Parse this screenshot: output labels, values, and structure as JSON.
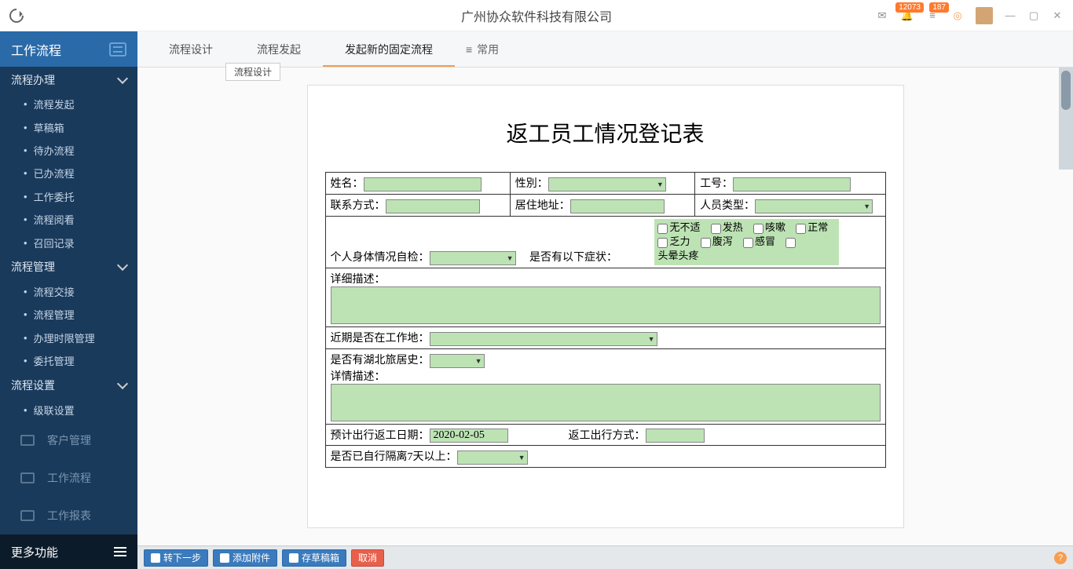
{
  "title": "广州协众软件科技有限公司",
  "badges": {
    "bell": "12073",
    "list": "187"
  },
  "sidebar": {
    "header": "工作流程",
    "group1": "流程办理",
    "items1": [
      "流程发起",
      "草稿箱",
      "待办流程",
      "已办流程",
      "工作委托",
      "流程阅看",
      "召回记录"
    ],
    "group2": "流程管理",
    "items2": [
      "流程交接",
      "流程管理",
      "办理时限管理",
      "委托管理"
    ],
    "group3": "流程设置",
    "items3": [
      "级联设置"
    ],
    "big": [
      "客户管理",
      "工作流程",
      "工作报表"
    ],
    "more": "更多功能"
  },
  "tabs": [
    "流程设计",
    "流程发起",
    "发起新的固定流程"
  ],
  "tabMore": "常用",
  "tooltip": "流程设计",
  "form": {
    "title": "返工员工情况登记表",
    "name": "姓名：",
    "gender": "性別：",
    "empno": "工号：",
    "contact": "联系方式：",
    "address": "居住地址：",
    "ptype": "人员类型：",
    "selfcheck": "个人身体情况自检：",
    "symptomQ": "是否有以下症状：",
    "symptoms": [
      "无不适",
      "发热",
      "咳嗽",
      "正常",
      "乏力",
      "腹泻",
      "感冒",
      "头晕头疼"
    ],
    "detail": "详细描述：",
    "recentLoc": "近期是否在工作地：",
    "hubei": "是否有湖北旅居史：",
    "detail2": "详情描述：",
    "returnDate": "预计出行返工日期：",
    "returnDateVal": "2020-02-05",
    "returnWay": "返工出行方式：",
    "quarantine": "是否已自行隔离7天以上："
  },
  "footer": {
    "next": "转下一步",
    "attach": "添加附件",
    "draft": "存草稿箱",
    "cancel": "取消"
  }
}
